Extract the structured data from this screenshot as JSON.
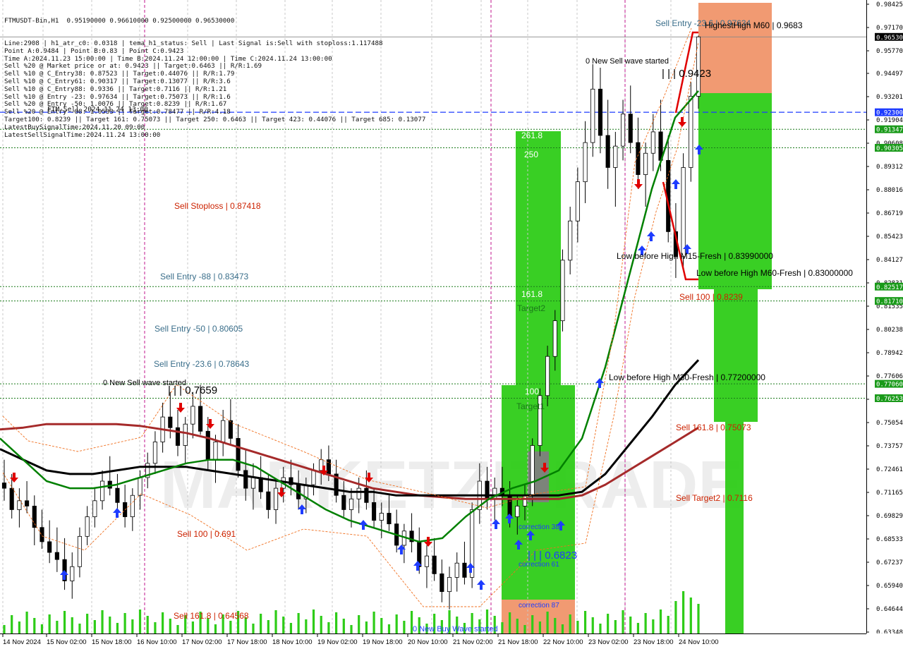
{
  "header": {
    "symbol_line": "FTMUSDT-Bin,H1  0.95190000 0.96610000 0.92500000 0.96530000",
    "info_lines": [
      "Line:2908 | h1_atr_c0: 0.0318 | tema_h1_status: Sell | Last Signal is:Sell with stoploss:1.117488",
      "Point A:0.9484 | Point B:0.83 | Point C:0.9423",
      "Time A:2024.11.23 15:00:00 | Time B:2024.11.24 12:00:00 | Time C:2024.11.24 13:00:00",
      "Sell %20 @ Market price or at: 0.9423 || Target:0.6463 || R/R:1.69",
      "Sell %10 @ C_Entry38: 0.87523 || Target:0.44076 || R/R:1.79",
      "Sell %10 @ C_Entry61: 0.90317 || Target:0.13077 || R/R:3.6",
      "Sell %10 @ C_Entry88: 0.9336 || Target:0.7116 || R/R:1.21",
      "Sell %10 @ Entry -23: 0.97634 || Target:0.75073 || R/R:1.6",
      "Sell %20 @ Entry -50: 1.0076 || Target:0.8239 || R/R:1.67",
      "Sell %20 @ Entry -88: 1.0533 || Target:0.78477 || R/R:4.18",
      "Target100: 0.8239 || Target 161: 0.75073 || Target 250: 0.6463 || Target 423: 0.44076 || Target 685: 0.13077",
      "LatestBuySignalTime:2024.11.20 09:00",
      "LatestSellSignalTime:2024.11.24 13:00:00"
    ],
    "overlap_text": "FTM-Sell 2024.11.24 13:00"
  },
  "watermark": "MARKETZITRADE",
  "colors": {
    "background": "#ffffff",
    "bull": "#000000",
    "bear": "#000000",
    "ma_green": "#008000",
    "ma_black": "#000000",
    "ma_darkred": "#a52a2a",
    "zone_green": "#2ecc18",
    "zone_orange": "#f0956a",
    "zone_gray": "#808080",
    "sell_label": "#cc2200",
    "entry_label": "#3a6e8a",
    "target_label": "#1a7a1a",
    "current_price_box": "#000000",
    "blue_level_box": "#1e3cff",
    "green_level_box": "#1a9a1a"
  },
  "chart_labels": {
    "sell_entry_top": "Sell Entry -23.6 | 0.97634",
    "highest_high": "HighestHigh   M60 | 0.9683",
    "new_sell_wave_right": "0 New Sell wave started",
    "point_c": "| | | 0.9423",
    "fib_2618": "261.8",
    "fib_250": "250",
    "sell_stoploss": "Sell Stoploss | 0.87418",
    "low_before_high_m15": "Low before High   M15-Fresh | 0.83990000",
    "low_before_high_m60": "Low before High   M60-Fresh | 0.83000000",
    "sell_entry_88": "Sell Entry -88 | 0.83473",
    "fib_1618": "161.8",
    "target2": "Target2",
    "sell_100_right": "Sell 100 | 0.8239",
    "sell_entry_50": "Sell Entry -50 | 0.80605",
    "sell_entry_236": "Sell Entry -23.6 | 0.78643",
    "low_before_high_m30": "Low before High   M30-Fresh | 0.77200000",
    "new_sell_wave_left": "0 New Sell wave started",
    "point_left": "| | | 0.7659",
    "fib_100": "100",
    "target1": "Target1",
    "sell_1618_right": "Sell 161.8 | 0.75073",
    "sell_target2_right": "Sell Target2 | 0.7116",
    "correction_38": "correction 38",
    "sell_100_left": "Sell 100 | 0.691",
    "point_b_low": "| | | 0.6823",
    "correction_61": "correction 61",
    "correction_87": "correction 87",
    "sell_1618_left": "Sell 161.8 | 0.64568",
    "new_buy_wave": "0 New Buy Wave started"
  },
  "chart_data": {
    "type": "candlestick",
    "title": "FTMUSDT-Bin,H1",
    "ylim": [
      0.6305,
      0.986
    ],
    "y_ticks": [
      "0.98425",
      "0.97170",
      "0.95770",
      "0.94497",
      "0.93201",
      "0.91904",
      "0.90608",
      "0.89312",
      "0.88016",
      "0.86719",
      "0.85423",
      "0.84127",
      "0.82831",
      "0.81535",
      "0.80238",
      "0.78942",
      "0.77606",
      "0.76350",
      "0.75054",
      "0.73757",
      "0.72461",
      "0.71165",
      "0.69829",
      "0.68533",
      "0.67237",
      "0.65940",
      "0.64644",
      "0.63348"
    ],
    "x_ticks": [
      "14 Nov 2024",
      "15 Nov 02:00",
      "15 Nov 18:00",
      "16 Nov 10:00",
      "17 Nov 02:00",
      "17 Nov 18:00",
      "18 Nov 10:00",
      "19 Nov 02:00",
      "19 Nov 18:00",
      "20 Nov 10:00",
      "21 Nov 02:00",
      "21 Nov 18:00",
      "22 Nov 10:00",
      "23 Nov 02:00",
      "23 Nov 18:00",
      "24 Nov 10:00"
    ],
    "price_boxes": [
      {
        "value": 0.9653,
        "label": "0.96530",
        "kind": "current"
      },
      {
        "value": 0.923,
        "label": "0.92300",
        "kind": "blue"
      },
      {
        "value": 0.91347,
        "label": "0.91347",
        "kind": "green"
      },
      {
        "value": 0.90305,
        "label": "0.90305",
        "kind": "green"
      },
      {
        "value": 0.82517,
        "label": "0.82517",
        "kind": "green"
      },
      {
        "value": 0.8171,
        "label": "0.81710",
        "kind": "green"
      },
      {
        "value": 0.7706,
        "label": "0.77060",
        "kind": "green"
      },
      {
        "value": 0.76253,
        "label": "0.76253",
        "kind": "green"
      }
    ],
    "ohlc": [
      [
        0.715,
        0.728,
        0.705,
        0.712
      ],
      [
        0.712,
        0.72,
        0.695,
        0.7
      ],
      [
        0.7,
        0.712,
        0.69,
        0.705
      ],
      [
        0.705,
        0.716,
        0.698,
        0.702
      ],
      [
        0.702,
        0.708,
        0.68,
        0.69
      ],
      [
        0.69,
        0.7,
        0.678,
        0.682
      ],
      [
        0.682,
        0.694,
        0.67,
        0.676
      ],
      [
        0.676,
        0.69,
        0.665,
        0.672
      ],
      [
        0.672,
        0.684,
        0.655,
        0.66
      ],
      [
        0.66,
        0.676,
        0.65,
        0.668
      ],
      [
        0.668,
        0.69,
        0.662,
        0.685
      ],
      [
        0.685,
        0.702,
        0.68,
        0.696
      ],
      [
        0.696,
        0.712,
        0.69,
        0.705
      ],
      [
        0.705,
        0.722,
        0.7,
        0.716
      ],
      [
        0.716,
        0.73,
        0.708,
        0.712
      ],
      [
        0.712,
        0.72,
        0.7,
        0.704
      ],
      [
        0.704,
        0.714,
        0.69,
        0.696
      ],
      [
        0.696,
        0.712,
        0.688,
        0.708
      ],
      [
        0.708,
        0.722,
        0.7,
        0.718
      ],
      [
        0.718,
        0.732,
        0.712,
        0.726
      ],
      [
        0.726,
        0.744,
        0.72,
        0.738
      ],
      [
        0.738,
        0.76,
        0.732,
        0.752
      ],
      [
        0.752,
        0.766,
        0.74,
        0.746
      ],
      [
        0.746,
        0.756,
        0.73,
        0.736
      ],
      [
        0.736,
        0.752,
        0.726,
        0.748
      ],
      [
        0.748,
        0.766,
        0.74,
        0.758
      ],
      [
        0.758,
        0.77,
        0.742,
        0.744
      ],
      [
        0.744,
        0.752,
        0.722,
        0.728
      ],
      [
        0.728,
        0.742,
        0.715,
        0.738
      ],
      [
        0.738,
        0.756,
        0.73,
        0.75
      ],
      [
        0.75,
        0.762,
        0.736,
        0.74
      ],
      [
        0.74,
        0.748,
        0.718,
        0.722
      ],
      [
        0.722,
        0.734,
        0.705,
        0.712
      ],
      [
        0.712,
        0.726,
        0.7,
        0.718
      ],
      [
        0.718,
        0.73,
        0.706,
        0.71
      ],
      [
        0.71,
        0.72,
        0.695,
        0.7
      ],
      [
        0.7,
        0.716,
        0.692,
        0.712
      ],
      [
        0.712,
        0.724,
        0.704,
        0.718
      ],
      [
        0.718,
        0.728,
        0.708,
        0.714
      ],
      [
        0.714,
        0.722,
        0.7,
        0.706
      ],
      [
        0.706,
        0.718,
        0.698,
        0.714
      ],
      [
        0.714,
        0.726,
        0.708,
        0.722
      ],
      [
        0.722,
        0.734,
        0.714,
        0.728
      ],
      [
        0.728,
        0.736,
        0.716,
        0.72
      ],
      [
        0.72,
        0.728,
        0.704,
        0.708
      ],
      [
        0.708,
        0.716,
        0.696,
        0.7
      ],
      [
        0.7,
        0.712,
        0.69,
        0.706
      ],
      [
        0.706,
        0.718,
        0.698,
        0.712
      ],
      [
        0.712,
        0.722,
        0.7,
        0.704
      ],
      [
        0.704,
        0.712,
        0.69,
        0.694
      ],
      [
        0.694,
        0.704,
        0.684,
        0.698
      ],
      [
        0.698,
        0.708,
        0.688,
        0.692
      ],
      [
        0.692,
        0.7,
        0.676,
        0.68
      ],
      [
        0.68,
        0.692,
        0.67,
        0.688
      ],
      [
        0.688,
        0.698,
        0.676,
        0.682
      ],
      [
        0.682,
        0.69,
        0.664,
        0.668
      ],
      [
        0.668,
        0.68,
        0.656,
        0.674
      ],
      [
        0.674,
        0.684,
        0.66,
        0.664
      ],
      [
        0.664,
        0.672,
        0.648,
        0.654
      ],
      [
        0.654,
        0.668,
        0.644,
        0.662
      ],
      [
        0.662,
        0.676,
        0.654,
        0.67
      ],
      [
        0.67,
        0.682,
        0.658,
        0.662
      ],
      [
        0.662,
        0.704,
        0.656,
        0.7
      ],
      [
        0.7,
        0.726,
        0.692,
        0.716
      ],
      [
        0.716,
        0.724,
        0.7,
        0.706
      ],
      [
        0.706,
        0.718,
        0.694,
        0.712
      ],
      [
        0.712,
        0.724,
        0.702,
        0.708
      ],
      [
        0.708,
        0.716,
        0.69,
        0.696
      ],
      [
        0.696,
        0.708,
        0.686,
        0.702
      ],
      [
        0.702,
        0.714,
        0.694,
        0.708
      ],
      [
        0.708,
        0.74,
        0.702,
        0.736
      ],
      [
        0.736,
        0.768,
        0.73,
        0.764
      ],
      [
        0.764,
        0.792,
        0.758,
        0.786
      ],
      [
        0.786,
        0.812,
        0.778,
        0.806
      ],
      [
        0.806,
        0.846,
        0.8,
        0.84
      ],
      [
        0.84,
        0.87,
        0.832,
        0.862
      ],
      [
        0.862,
        0.892,
        0.85,
        0.884
      ],
      [
        0.884,
        0.918,
        0.872,
        0.906
      ],
      [
        0.906,
        0.95,
        0.898,
        0.936
      ],
      [
        0.936,
        0.948,
        0.9,
        0.91
      ],
      [
        0.91,
        0.93,
        0.88,
        0.892
      ],
      [
        0.892,
        0.912,
        0.87,
        0.904
      ],
      [
        0.904,
        0.93,
        0.896,
        0.922
      ],
      [
        0.922,
        0.938,
        0.9,
        0.906
      ],
      [
        0.906,
        0.92,
        0.88,
        0.888
      ],
      [
        0.888,
        0.906,
        0.87,
        0.9
      ],
      [
        0.9,
        0.922,
        0.89,
        0.912
      ],
      [
        0.912,
        0.93,
        0.89,
        0.896
      ],
      [
        0.896,
        0.91,
        0.85,
        0.856
      ],
      [
        0.856,
        0.872,
        0.83,
        0.842
      ],
      [
        0.842,
        0.9,
        0.836,
        0.892
      ],
      [
        0.892,
        0.94,
        0.884,
        0.932
      ],
      [
        0.932,
        0.966,
        0.925,
        0.9653
      ]
    ],
    "ma_green": [
      0.74,
      0.728,
      0.716,
      0.712,
      0.712,
      0.714,
      0.718,
      0.722,
      0.726,
      0.728,
      0.728,
      0.724,
      0.716,
      0.708,
      0.7,
      0.694,
      0.69,
      0.686,
      0.682,
      0.684,
      0.696,
      0.706,
      0.712,
      0.716,
      0.722,
      0.74,
      0.78,
      0.83,
      0.88,
      0.92,
      0.935
    ],
    "ma_black": [
      0.734,
      0.728,
      0.722,
      0.72,
      0.72,
      0.722,
      0.724,
      0.724,
      0.724,
      0.722,
      0.72,
      0.718,
      0.716,
      0.714,
      0.712,
      0.71,
      0.71,
      0.708,
      0.708,
      0.708,
      0.708,
      0.708,
      0.708,
      0.708,
      0.708,
      0.71,
      0.72,
      0.736,
      0.752,
      0.77,
      0.784
    ],
    "ma_darkred": [
      0.745,
      0.746,
      0.748,
      0.748,
      0.748,
      0.748,
      0.747,
      0.745,
      0.743,
      0.74,
      0.736,
      0.732,
      0.728,
      0.724,
      0.72,
      0.716,
      0.712,
      0.71,
      0.708,
      0.707,
      0.706,
      0.706,
      0.706,
      0.706,
      0.706,
      0.708,
      0.714,
      0.722,
      0.73,
      0.738,
      0.746
    ]
  }
}
